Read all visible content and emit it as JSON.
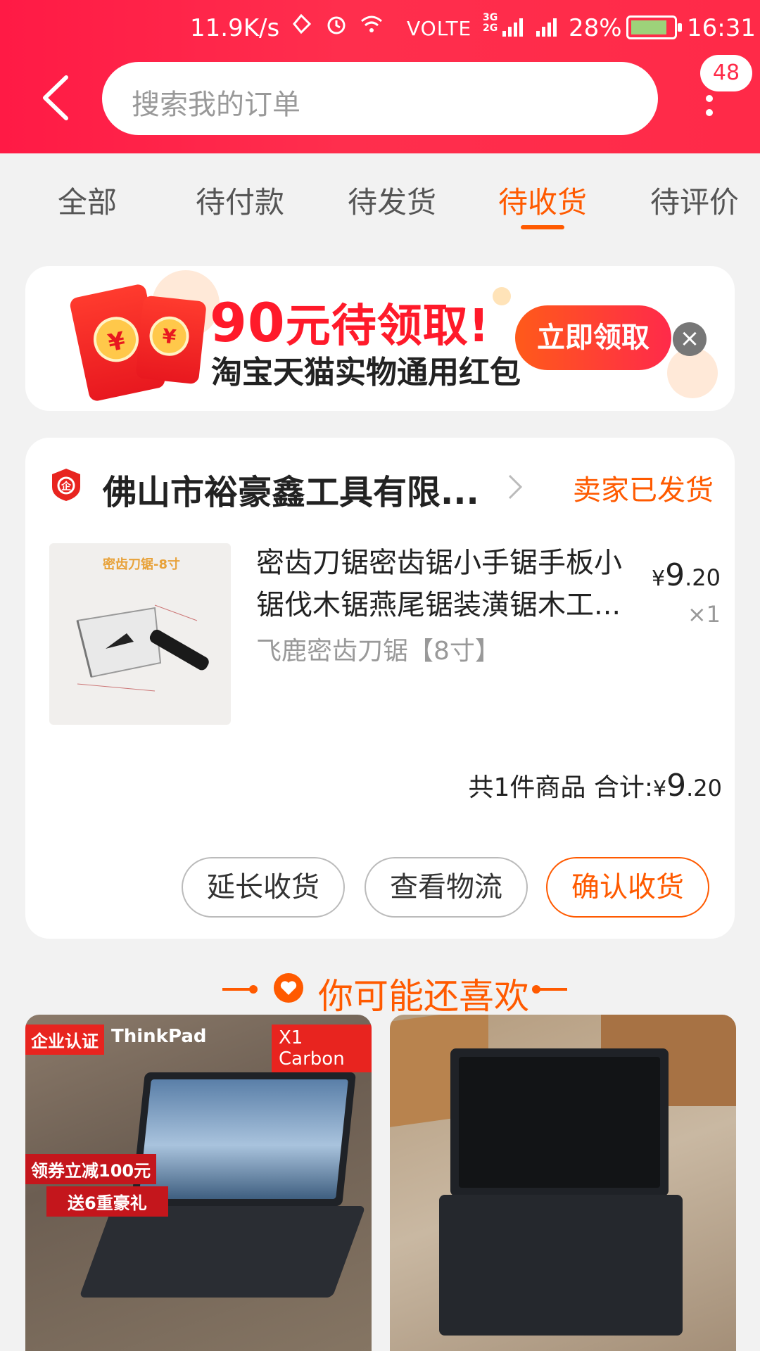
{
  "status_bar": {
    "net_speed": "11.9K/s",
    "volte": "VOLTE",
    "net_types": "3G 2G",
    "battery_pct": "28%",
    "time": "16:31"
  },
  "header": {
    "search_placeholder": "搜索我的订单",
    "badge_count": "48",
    "icons": [
      "back-arrow-icon",
      "more-vertical-icon"
    ]
  },
  "tabs": [
    {
      "label": "全部",
      "active": false
    },
    {
      "label": "待付款",
      "active": false
    },
    {
      "label": "待发货",
      "active": false
    },
    {
      "label": "待收货",
      "active": true
    },
    {
      "label": "待评价",
      "active": false
    }
  ],
  "promo": {
    "amount": "90",
    "headline_suffix": "元待领取!",
    "subline": "淘宝天猫实物通用红包",
    "button": "立即领取",
    "close": "×"
  },
  "order": {
    "shop_name": "佛山市裕豪鑫工具有限...",
    "status": "卖家已发货",
    "product": {
      "image_caption": "密齿刀锯-8寸",
      "title": "密齿刀锯密齿锯小手锯手板小锯伐木锯燕尾锯装潢锯木工...",
      "sku": "飞鹿密齿刀锯【8寸】",
      "price_symbol": "¥",
      "price_int": "9",
      "price_dec": ".20",
      "qty": "×1"
    },
    "summary": {
      "label": "共1件商品 合计:",
      "symbol": "¥",
      "total_int": "9",
      "total_dec": ".20"
    },
    "buttons": [
      "延长收货",
      "查看物流",
      "确认收货"
    ]
  },
  "recommend": {
    "title": "你可能还喜欢",
    "cards": [
      {
        "tags": [
          "企业认证",
          "ThinkPad",
          "X1 Carbon",
          "领券立减100元",
          "送6重豪礼"
        ]
      },
      {
        "tags": []
      }
    ]
  },
  "colors": {
    "brand_red": "#ff2a48",
    "accent_orange": "#ff5a00",
    "background": "#f2f2f2"
  }
}
